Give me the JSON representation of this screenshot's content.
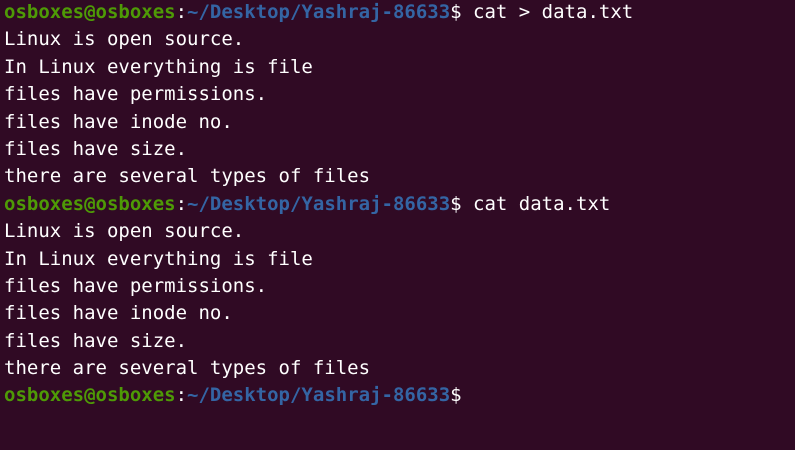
{
  "terminal": {
    "user_host": "osboxes@osboxes",
    "colon": ":",
    "path": "~/Desktop/Yashraj-86633",
    "dollar": "$",
    "colors": {
      "background": "#300a24",
      "user_host": "#4e9a06",
      "path": "#3465a4",
      "text": "#ffffff"
    },
    "commands": [
      {
        "command": " cat > data.txt",
        "output": [
          "Linux is open source.",
          "In Linux everything is file",
          "files have permissions.",
          "files have inode no.",
          "files have size.",
          "there are several types of files"
        ]
      },
      {
        "command": " cat data.txt",
        "output": [
          "Linux is open source.",
          "In Linux everything is file",
          "files have permissions.",
          "files have inode no.",
          "files have size.",
          "there are several types of files"
        ]
      }
    ],
    "final_prompt_command": ""
  }
}
